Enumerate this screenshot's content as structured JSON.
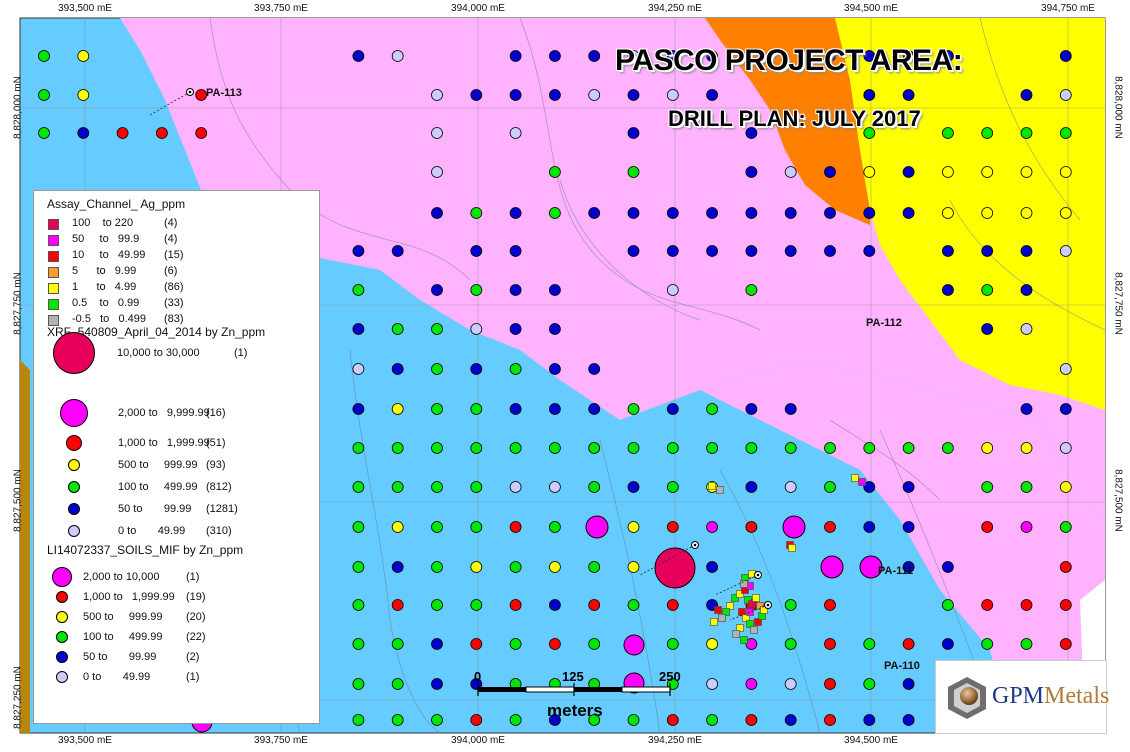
{
  "title": "PASCO PROJECT AREA:",
  "subtitle": "DRILL PLAN: JULY 2017",
  "easting_labels": [
    "393,500 mE",
    "393,750 mE",
    "394,000 mE",
    "394,250 mE",
    "394,500 mE",
    "394,750 mE"
  ],
  "northing_labels": [
    "8,828,000 mN",
    "8,827,750 mN",
    "8,827,500 mN",
    "8,827,250 mN"
  ],
  "drill_holes": [
    "PA-113",
    "PA-112",
    "PA-111",
    "PA-110"
  ],
  "scale": {
    "ticks": [
      "0",
      "125",
      "250"
    ],
    "unit": "meters"
  },
  "colors": {
    "blue_zone": "#66ccff",
    "pink_zone": "#ffb3ff",
    "orange_zone": "#ff8000",
    "yellow_zone": "#ffff00",
    "brown_zone": "#b8860b",
    "dot_magenta": "#ff00ff",
    "dot_red": "#ff0000",
    "dot_yellow": "#ffff00",
    "dot_green": "#00e600",
    "dot_blue": "#0000cc",
    "dot_lav": "#ccccff",
    "dot_crimson": "#e6005c"
  },
  "legend": {
    "assay": {
      "title": "Assay_Channel_ Ag_ppm",
      "rows": [
        {
          "from": "100",
          "to": "to 220",
          "count": "(4)",
          "color": "#e6005c"
        },
        {
          "from": "50",
          "to": "to   99.9",
          "count": "(4)",
          "color": "#ff00ff"
        },
        {
          "from": "10",
          "to": "to   49.99",
          "count": "(15)",
          "color": "#ff0000"
        },
        {
          "from": "5",
          "to": "to   9.99",
          "count": "(6)",
          "color": "#ff9933"
        },
        {
          "from": "1",
          "to": "to   4.99",
          "count": "(86)",
          "color": "#ffff00"
        },
        {
          "from": "0.5",
          "to": "to   0.99",
          "count": "(33)",
          "color": "#00e600"
        },
        {
          "from": "-0.5",
          "to": "to   0.499",
          "count": "(83)",
          "color": "#b3b3b3"
        }
      ]
    },
    "xrf": {
      "title": "XRF_540809_April_04_2014 by Zn_ppm",
      "rows": [
        {
          "label": "10,000 to 30,000",
          "count": "(1)",
          "color": "#e6005c"
        },
        {
          "label": "2,000 to   9,999.99",
          "count": "(16)",
          "color": "#ff00ff"
        },
        {
          "label": "1,000 to   1,999.99",
          "count": "(51)",
          "color": "#ff0000"
        },
        {
          "label": "500 to     999.99",
          "count": "(93)",
          "color": "#ffff00"
        },
        {
          "label": "100 to     499.99",
          "count": "(812)",
          "color": "#00e600"
        },
        {
          "label": "50 to       99.99",
          "count": "(1281)",
          "color": "#0000cc"
        },
        {
          "label": "0 to       49.99",
          "count": "(310)",
          "color": "#ccccff"
        }
      ]
    },
    "soils": {
      "title": "LI14072337_SOILS_MIF by Zn_ppm",
      "rows": [
        {
          "label": "2,000 to 10,000",
          "count": "(1)",
          "color": "#ff00ff"
        },
        {
          "label": "1,000 to   1,999.99",
          "count": "(19)",
          "color": "#ff0000"
        },
        {
          "label": "500 to     999.99",
          "count": "(20)",
          "color": "#ffff00"
        },
        {
          "label": "100 to     499.99",
          "count": "(22)",
          "color": "#00e600"
        },
        {
          "label": "50 to       99.99",
          "count": "(2)",
          "color": "#0000cc"
        },
        {
          "label": "0 to       49.99",
          "count": "(1)",
          "color": "#ccccff"
        }
      ]
    }
  },
  "logo": {
    "text": "GPM",
    "text2": "Metals"
  }
}
